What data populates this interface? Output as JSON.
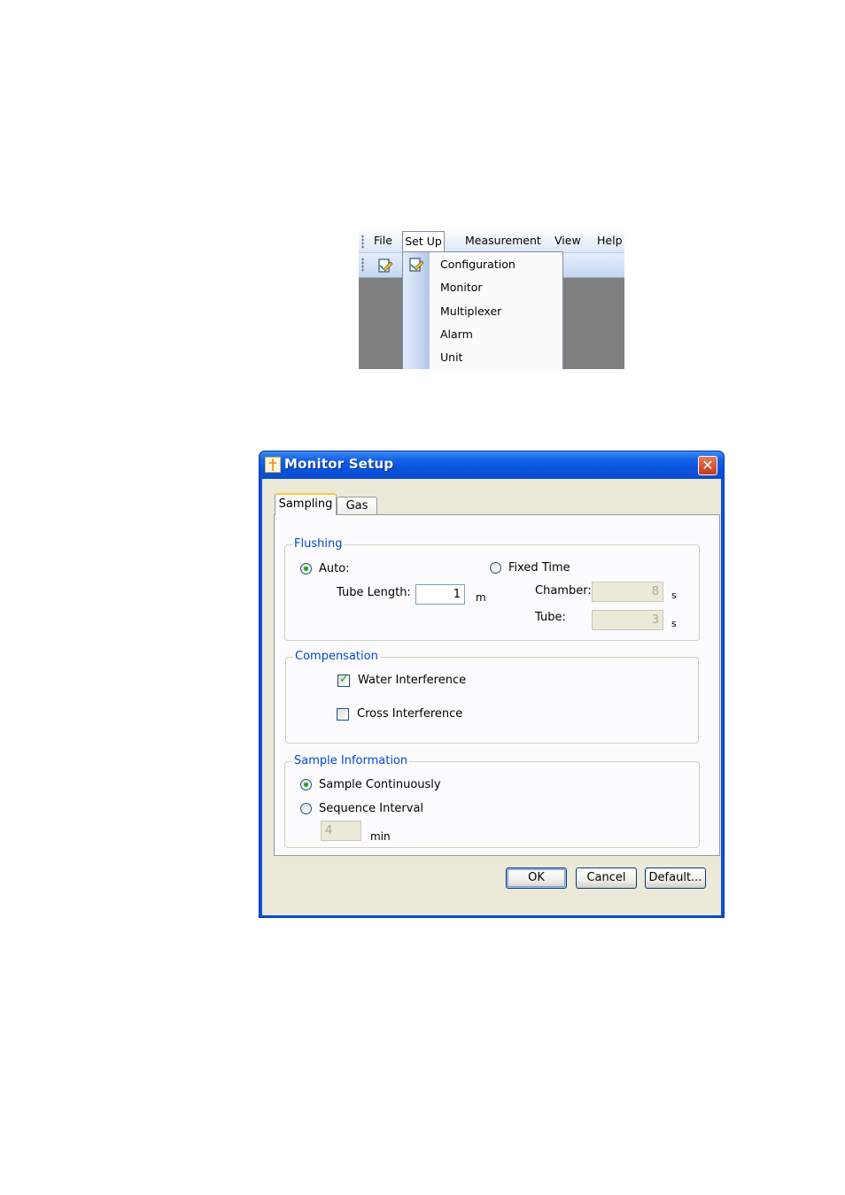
{
  "menu": {
    "items": [
      "File",
      "Set Up",
      "Measurement",
      "View",
      "Help"
    ],
    "dropdown": [
      "Configuration",
      "Monitor",
      "Multiplexer",
      "Alarm",
      "Unit"
    ]
  },
  "dialog": {
    "title": "Monitor Setup",
    "tabs": [
      "Sampling",
      "Gas"
    ],
    "flushing": {
      "legend": "Flushing",
      "auto_label": "Auto:",
      "fixed_label": "Fixed Time",
      "tube_length_label": "Tube Length:",
      "tube_length_value": "1",
      "tube_length_unit": "m",
      "chamber_label": "Chamber:",
      "chamber_value": "8",
      "chamber_unit": "s",
      "tube_label": "Tube:",
      "tube_value": "3",
      "tube_unit": "s"
    },
    "compensation": {
      "legend": "Compensation",
      "water_label": "Water Interference",
      "cross_label": "Cross Interference"
    },
    "sample": {
      "legend": "Sample Information",
      "continuous_label": "Sample Continuously",
      "interval_label": "Sequence Interval",
      "interval_value": "4",
      "interval_unit": "min"
    },
    "buttons": {
      "ok": "OK",
      "cancel": "Cancel",
      "default": "Default..."
    }
  },
  "colors": {
    "title_bar": "#0a52dd",
    "legend_text": "#0046d5",
    "client_bg": "#ece9d8",
    "close_button": "#c4391b"
  }
}
